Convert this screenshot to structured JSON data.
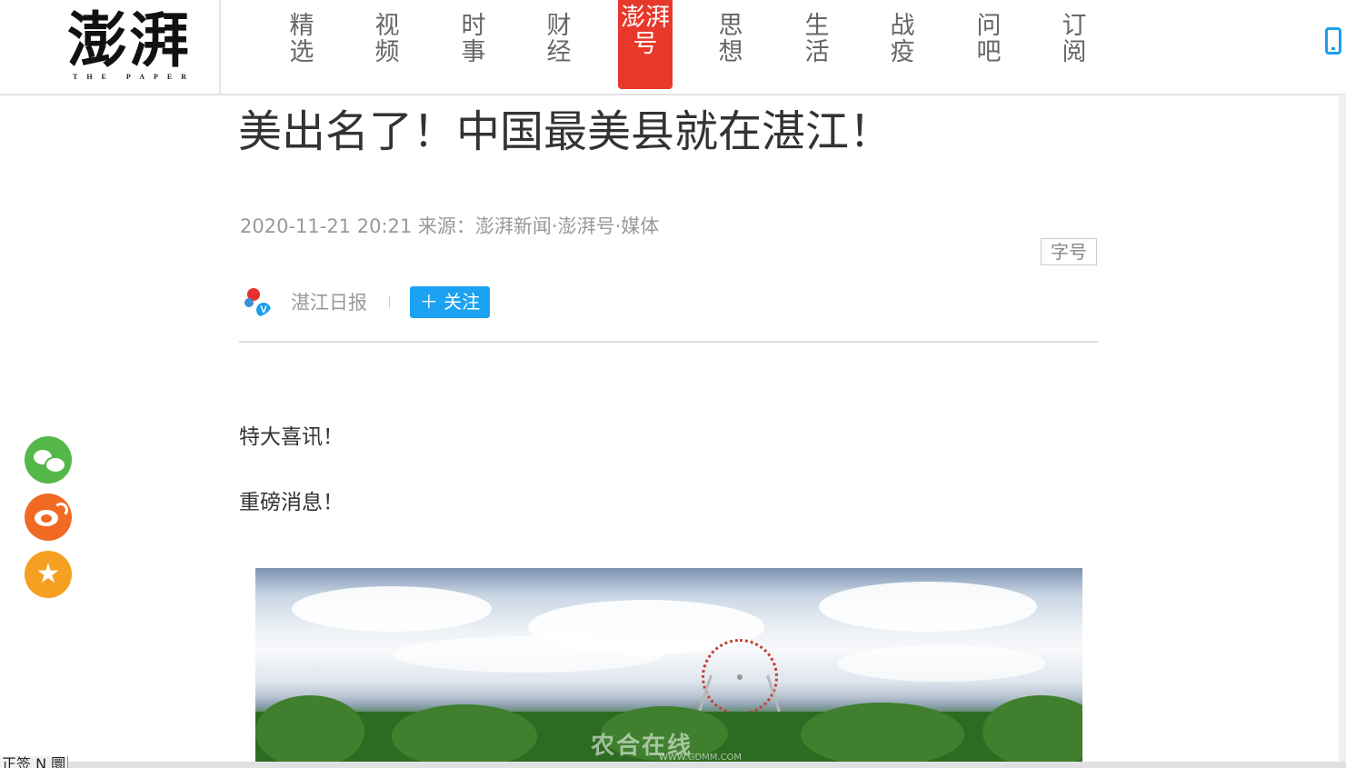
{
  "header": {
    "logo_main": "澎湃",
    "logo_sub": "THE PAPER",
    "nav": [
      {
        "label": "精选"
      },
      {
        "label": "视频"
      },
      {
        "label": "时事"
      },
      {
        "label": "财经"
      },
      {
        "label": "澎湃号"
      },
      {
        "label": "思想"
      },
      {
        "label": "生活"
      },
      {
        "label": "战疫"
      },
      {
        "label": "问吧"
      },
      {
        "label": "订阅"
      }
    ],
    "active_nav": "澎湃号",
    "icons": {
      "app": "phone-icon"
    }
  },
  "article": {
    "title": "美出名了！中国最美县就在湛江！",
    "meta": "2020-11-21 20:21 来源：澎湃新闻·澎湃号·媒体",
    "font_button": "字号",
    "author": {
      "name": "湛江日报",
      "verified_badge": "V"
    },
    "follow_button": "＋ 关注",
    "paragraphs": [
      "特大喜讯！",
      "重磅消息！"
    ],
    "image_watermark": "农合在线",
    "image_watermark_sub": "WWW.GDMM.COM"
  },
  "share": [
    {
      "name": "wechat-icon"
    },
    {
      "name": "weibo-icon"
    },
    {
      "name": "qzone-icon",
      "glyph": "★"
    }
  ],
  "status_fragment": "正签 N 圜",
  "colors": {
    "brand_red": "#e8382b",
    "follow_blue": "#1ba2f2",
    "wechat_green": "#53b848",
    "weibo_orange": "#f06a24",
    "qzone_yellow": "#f5a020"
  }
}
